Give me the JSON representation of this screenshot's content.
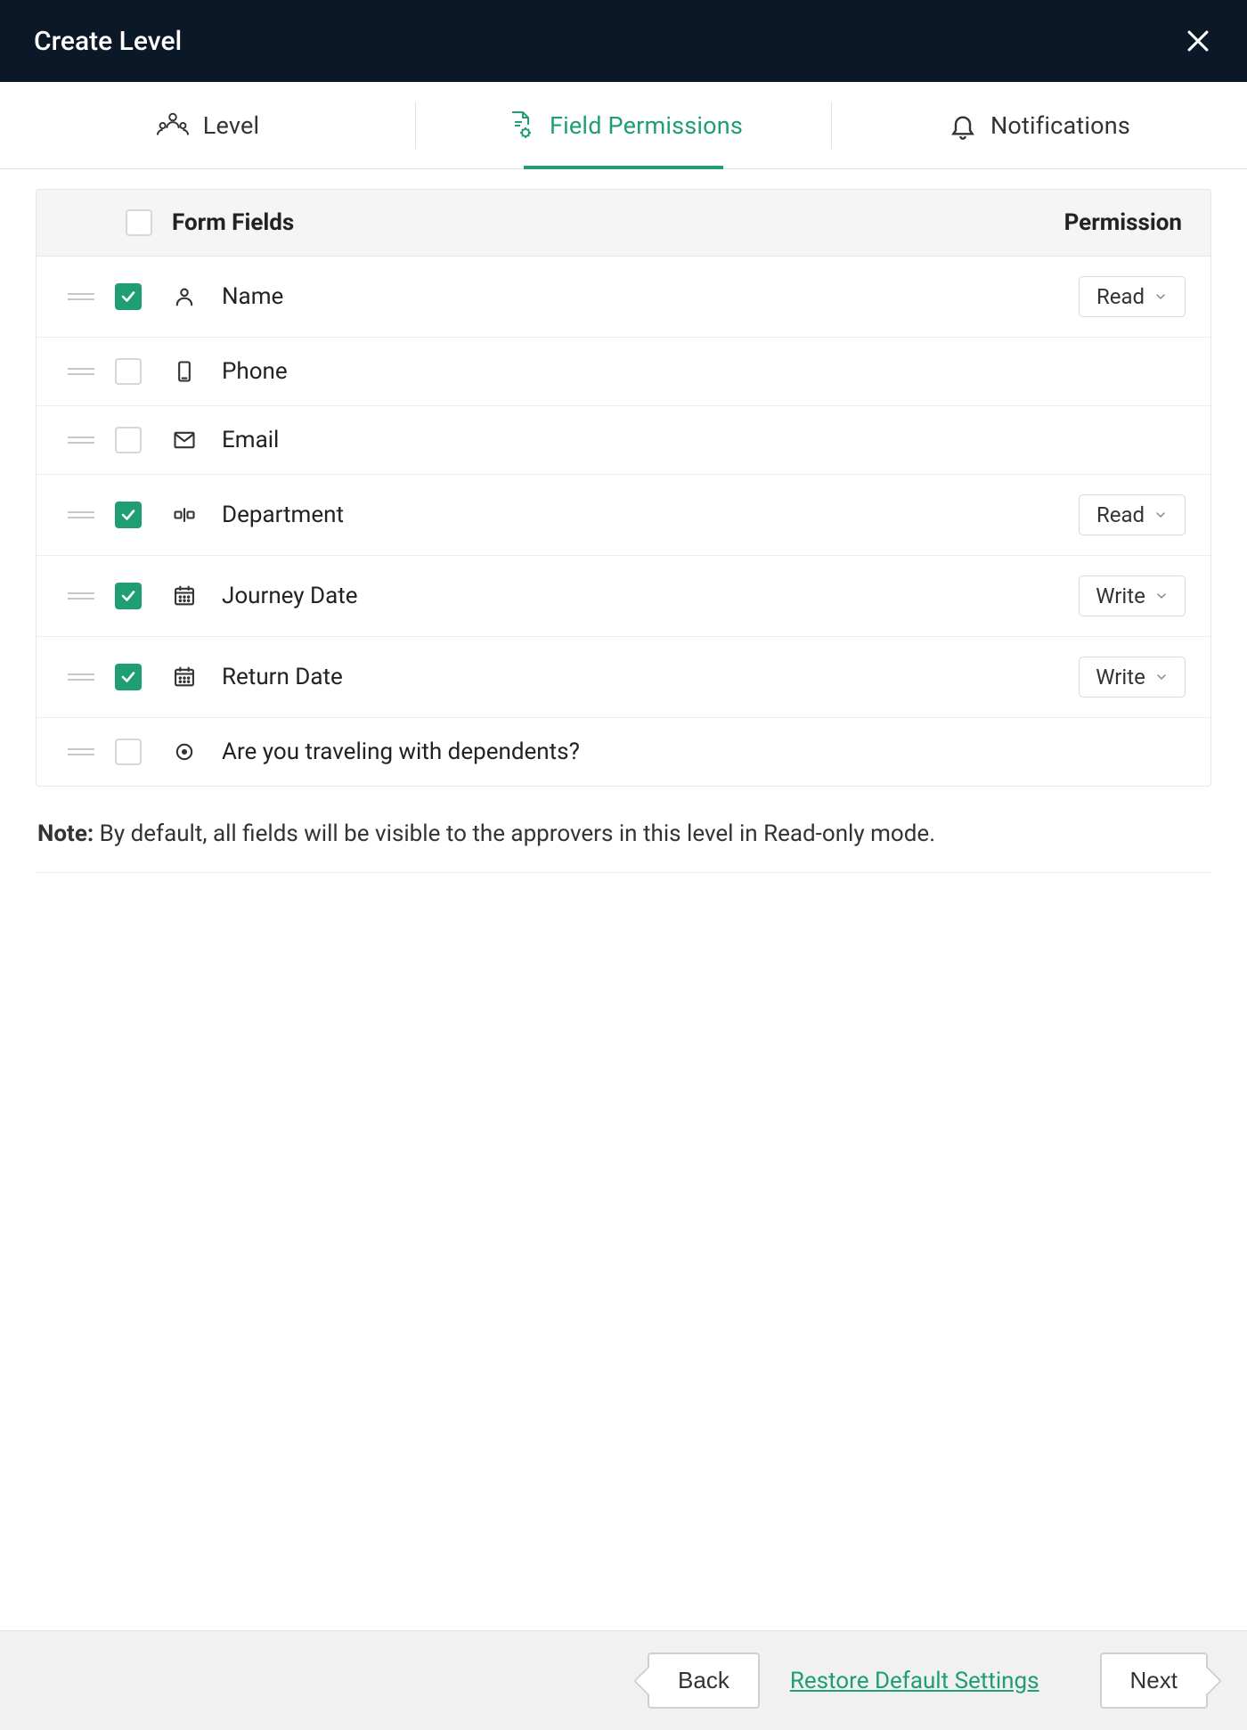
{
  "header": {
    "title": "Create Level"
  },
  "tabs": [
    {
      "id": "level",
      "label": "Level",
      "active": false,
      "icon": "people-icon"
    },
    {
      "id": "field-permissions",
      "label": "Field Permissions",
      "active": true,
      "icon": "doc-gear-icon"
    },
    {
      "id": "notifications",
      "label": "Notifications",
      "active": false,
      "icon": "bell-icon"
    }
  ],
  "table": {
    "headers": {
      "fields": "Form Fields",
      "permission": "Permission"
    },
    "select_all_checked": false,
    "rows": [
      {
        "icon": "person-icon",
        "label": "Name",
        "checked": true,
        "permission": "Read"
      },
      {
        "icon": "phone-icon",
        "label": "Phone",
        "checked": false,
        "permission": null
      },
      {
        "icon": "mail-icon",
        "label": "Email",
        "checked": false,
        "permission": null
      },
      {
        "icon": "department-icon",
        "label": "Department",
        "checked": true,
        "permission": "Read"
      },
      {
        "icon": "calendar-icon",
        "label": "Journey Date",
        "checked": true,
        "permission": "Write"
      },
      {
        "icon": "calendar-icon",
        "label": "Return Date",
        "checked": true,
        "permission": "Write"
      },
      {
        "icon": "radio-icon",
        "label": "Are you traveling with dependents?",
        "checked": false,
        "permission": null
      }
    ]
  },
  "note": {
    "prefix": "Note:",
    "text": " By default, all fields will be visible to the approvers in this level in Read-only mode."
  },
  "footer": {
    "back": "Back",
    "restore": "Restore Default Settings",
    "next": "Next"
  }
}
